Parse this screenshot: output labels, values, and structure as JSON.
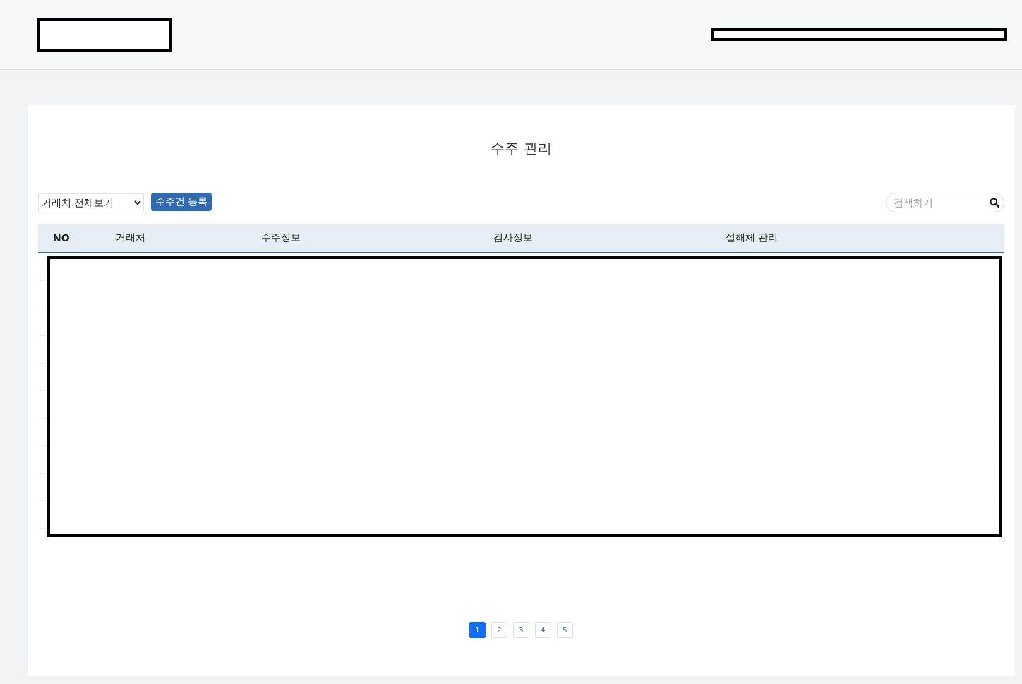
{
  "page_title": "수주 관리",
  "filter": {
    "value": "거래처 전체보기"
  },
  "register_button": "수주건 등록",
  "search": {
    "placeholder": "검색하기"
  },
  "table": {
    "columns": [
      "NO",
      "거래처",
      "수주정보",
      "검사정보",
      "설해체 관리"
    ]
  },
  "pagination": [
    {
      "label": "1",
      "selected": true
    },
    {
      "label": "2",
      "selected": false
    },
    {
      "label": "3",
      "selected": false
    },
    {
      "label": "4",
      "selected": false
    },
    {
      "label": "5",
      "selected": false
    }
  ]
}
